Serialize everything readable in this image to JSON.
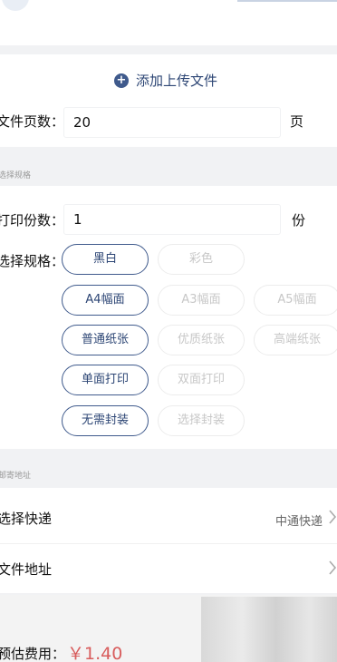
{
  "upload": {
    "add_file_label": "添加上传文件"
  },
  "pages": {
    "label": "文件页数：",
    "value": "20",
    "unit": "页"
  },
  "spec_section": {
    "title": "选择规格"
  },
  "copies": {
    "label": "打印份数：",
    "value": "1",
    "unit": "份"
  },
  "spec": {
    "label": "选择规格：",
    "color": [
      {
        "label": "黑白",
        "selected": true
      },
      {
        "label": "彩色",
        "selected": false
      }
    ],
    "size": [
      {
        "label": "A4幅面",
        "selected": true
      },
      {
        "label": "A3幅面",
        "selected": false
      },
      {
        "label": "A5幅面",
        "selected": false
      }
    ],
    "paper": [
      {
        "label": "普通纸张",
        "selected": true
      },
      {
        "label": "优质纸张",
        "selected": false
      },
      {
        "label": "高端纸张",
        "selected": false
      }
    ],
    "sides": [
      {
        "label": "单面打印",
        "selected": true
      },
      {
        "label": "双面打印",
        "selected": false
      }
    ],
    "binding": [
      {
        "label": "无需封装",
        "selected": true
      },
      {
        "label": "选择封装",
        "selected": false
      }
    ]
  },
  "address_section": {
    "title": "邮寄地址"
  },
  "delivery": {
    "label": "选择快递",
    "value": "中通快递"
  },
  "file_address": {
    "label": "文件地址"
  },
  "fee": {
    "label": "预估费用：",
    "value": "￥1.40"
  },
  "colors": {
    "accent": "#3f5a8c",
    "price": "#d85c5c",
    "background": "#f1f2f4"
  }
}
